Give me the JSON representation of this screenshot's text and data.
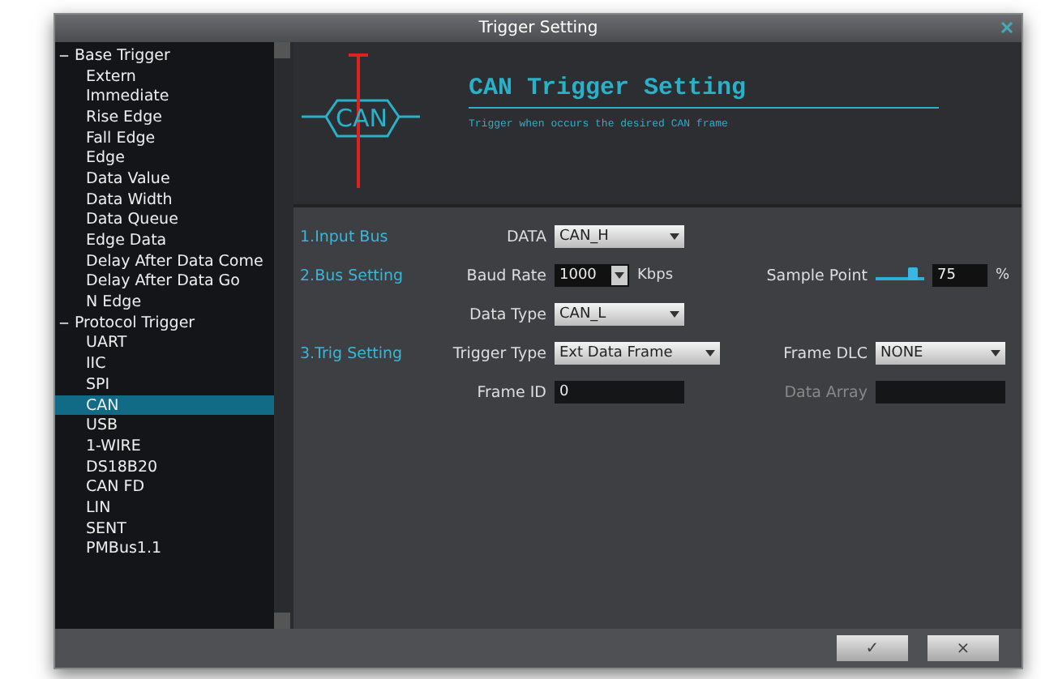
{
  "window": {
    "title": "Trigger Setting"
  },
  "tree": [
    {
      "label": "Base Trigger",
      "expanded": true,
      "selected": false,
      "children": [
        {
          "label": "Extern",
          "selected": false
        },
        {
          "label": "Immediate",
          "selected": false
        },
        {
          "label": "Rise Edge",
          "selected": false
        },
        {
          "label": "Fall Edge",
          "selected": false
        },
        {
          "label": "Edge",
          "selected": false
        },
        {
          "label": "Data Value",
          "selected": false
        },
        {
          "label": "Data Width",
          "selected": false
        },
        {
          "label": "Data Queue",
          "selected": false
        },
        {
          "label": "Edge Data",
          "selected": false
        },
        {
          "label": "Delay After Data Come",
          "selected": false
        },
        {
          "label": "Delay After Data Go",
          "selected": false
        },
        {
          "label": "N Edge",
          "selected": false
        }
      ]
    },
    {
      "label": "Protocol Trigger",
      "expanded": true,
      "selected": false,
      "children": [
        {
          "label": "UART",
          "selected": false
        },
        {
          "label": "IIC",
          "selected": false
        },
        {
          "label": "SPI",
          "selected": false
        },
        {
          "label": "CAN",
          "selected": true
        },
        {
          "label": "USB",
          "selected": false
        },
        {
          "label": "1-WIRE",
          "selected": false
        },
        {
          "label": "DS18B20",
          "selected": false
        },
        {
          "label": "CAN FD",
          "selected": false
        },
        {
          "label": "LIN",
          "selected": false
        },
        {
          "label": "SENT",
          "selected": false
        },
        {
          "label": "PMBus1.1",
          "selected": false
        }
      ]
    }
  ],
  "header": {
    "logo": "CAN",
    "title": "CAN Trigger Setting",
    "subtitle": "Trigger when occurs the desired CAN frame"
  },
  "sections": [
    {
      "label": "1.Input Bus",
      "rows": [
        [
          {
            "kind": "dropdown",
            "label": "DATA",
            "value": "CAN_H"
          }
        ]
      ]
    },
    {
      "label": "2.Bus Setting",
      "rows": [
        [
          {
            "kind": "spin",
            "label": "Baud Rate",
            "value": "1000",
            "unit": "Kbps"
          },
          {
            "kind": "slider",
            "label": "Sample Point",
            "level": 0.75,
            "value": "75",
            "unit": "%"
          }
        ],
        [
          {
            "kind": "dropdown",
            "label": "Data Type",
            "value": "CAN_L"
          }
        ]
      ]
    },
    {
      "label": "3.Trig Setting",
      "rows": [
        [
          {
            "kind": "dropdown",
            "label": "Trigger Type",
            "value": "Ext Data Frame"
          },
          {
            "kind": "dropdown",
            "label": "Frame DLC",
            "value": "NONE"
          }
        ],
        [
          {
            "kind": "input",
            "label": "Frame ID",
            "value": "0"
          },
          {
            "kind": "input",
            "label": "Data Array",
            "disabled": true
          }
        ]
      ]
    }
  ],
  "buttons": [
    "✓",
    "×"
  ]
}
